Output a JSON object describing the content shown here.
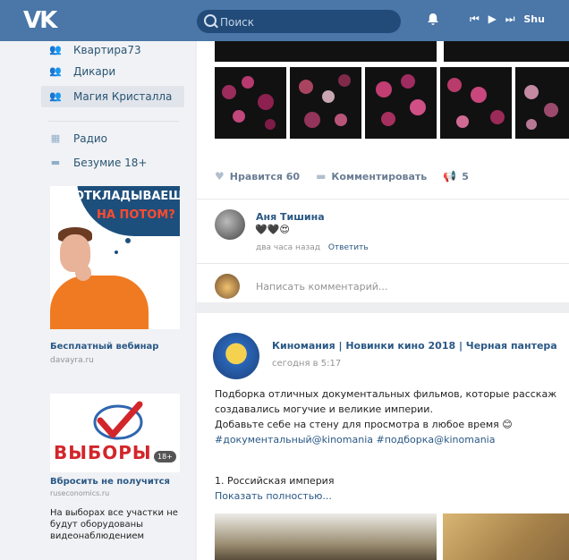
{
  "header": {
    "logo": "VK",
    "search_placeholder": "Поиск",
    "player_controls": [
      "⏮",
      "▶",
      "⏭"
    ],
    "player_shared": "Shu"
  },
  "sidebar": {
    "items": [
      {
        "label": "Квартира73",
        "icon": "group-icon"
      },
      {
        "label": "Дикари",
        "icon": "group-icon"
      },
      {
        "label": "Магия Кристалла",
        "icon": "group-icon",
        "active": true
      },
      {
        "label": "Радио",
        "icon": "apps-icon"
      },
      {
        "label": "Безумие 18+",
        "icon": "game-icon"
      }
    ]
  },
  "ads": [
    {
      "banner_line1": "ОТКЛАДЫВАЕШЬ",
      "banner_line2": "НА ПОТОМ?",
      "title": "Бесплатный вебинар",
      "domain": "davayra.ru"
    },
    {
      "banner_word": "ВЫБОРЫ",
      "age_badge": "18+",
      "title": "Вбросить не получится",
      "domain": "ruseconomics.ru",
      "description": "На выборах все участки не будут оборудованы видеонаблюдением"
    }
  ],
  "post1": {
    "actions": {
      "like_label": "Нравится",
      "like_count": "60",
      "comment_label": "Комментировать",
      "share_count": "5"
    },
    "comment": {
      "author": "Аня Тишина",
      "emoji": "🖤🖤😍",
      "time": "два часа назад",
      "reply_label": "Ответить"
    },
    "write_placeholder": "Написать комментарий..."
  },
  "post2": {
    "author": "Киномания | Новинки кино 2018 | Черная пантера",
    "date": "сегодня в 5:17",
    "text_lines": [
      "Подборка отличных документальных фильмов, которые расскаж",
      "создавались могучие и великие империи.",
      "Добавьте себе на стену для просмотра в любое время 😊"
    ],
    "tags": "#документальный@kinomania #подборка@kinomania",
    "list_item": "1. Российская империя",
    "show_more": "Показать полностью..."
  },
  "colors": {
    "header_bg": "#4a76a8",
    "link": "#2a5885",
    "page_bg": "#edeef0"
  }
}
